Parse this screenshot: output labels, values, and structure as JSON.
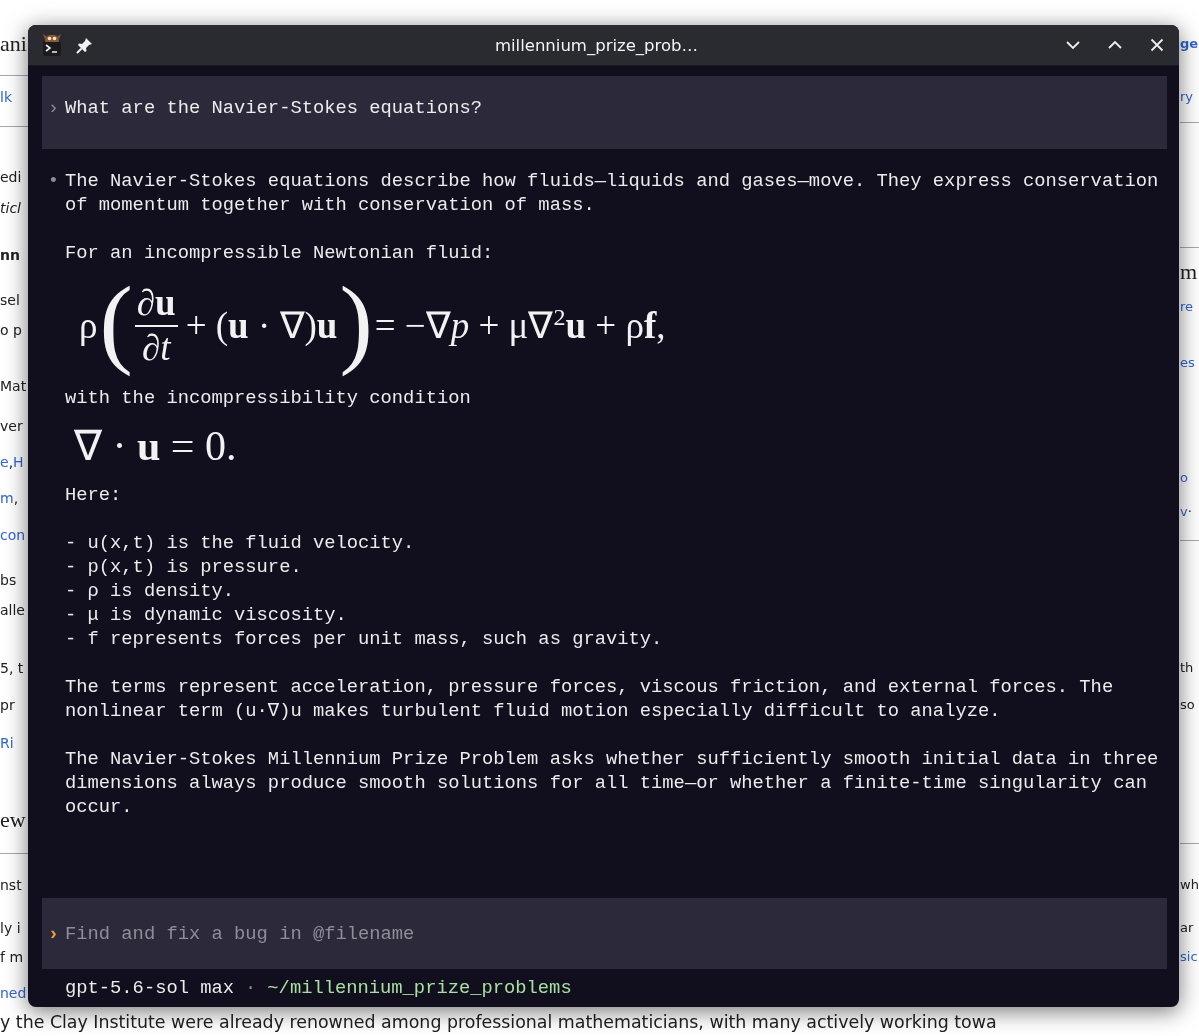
{
  "background_page": {
    "left_fragments": [
      {
        "kind": "heading",
        "parts": [
          {
            "text": "ani",
            "link": false
          }
        ]
      },
      {
        "kind": "text",
        "parts": [
          {
            "text": "lk",
            "link": true
          }
        ]
      },
      {
        "kind": "text",
        "parts": [
          {
            "text": "edi",
            "link": false
          }
        ]
      },
      {
        "kind": "italic",
        "parts": [
          {
            "text": "ticl",
            "link": false
          }
        ]
      },
      {
        "kind": "bold",
        "parts": [
          {
            "text": "nn",
            "link": false
          }
        ]
      },
      {
        "kind": "text",
        "parts": [
          {
            "text": "sel",
            "link": false
          }
        ]
      },
      {
        "kind": "text",
        "parts": [
          {
            "text": "o p",
            "link": false
          }
        ]
      },
      {
        "kind": "text",
        "parts": [
          {
            "text": "Mat",
            "link": false
          }
        ]
      },
      {
        "kind": "text",
        "parts": [
          {
            "text": "ver",
            "link": false
          }
        ]
      },
      {
        "kind": "text",
        "parts": [
          {
            "text": "e",
            "link": true
          },
          {
            "text": ",",
            "link": false
          },
          {
            "text": "H",
            "link": true
          }
        ]
      },
      {
        "kind": "text",
        "parts": [
          {
            "text": "m",
            "link": true
          },
          {
            "text": ",",
            "link": false
          }
        ]
      },
      {
        "kind": "text",
        "parts": [
          {
            "text": "con",
            "link": true
          }
        ]
      },
      {
        "kind": "text",
        "parts": [
          {
            "text": "bs",
            "link": false
          }
        ]
      },
      {
        "kind": "text",
        "parts": [
          {
            "text": "alle",
            "link": false
          }
        ]
      },
      {
        "kind": "text",
        "parts": [
          {
            "text": "5, t",
            "link": false
          }
        ]
      },
      {
        "kind": "text",
        "parts": [
          {
            "text": "pr",
            "link": false
          }
        ]
      },
      {
        "kind": "text",
        "parts": [
          {
            "text": "Ri",
            "link": true
          }
        ]
      },
      {
        "kind": "heading",
        "parts": [
          {
            "text": "ew",
            "link": false
          }
        ]
      },
      {
        "kind": "text",
        "parts": [
          {
            "text": "nst",
            "link": false
          }
        ]
      },
      {
        "kind": "text",
        "parts": [
          {
            "text": "ly i",
            "link": false
          }
        ]
      },
      {
        "kind": "text",
        "parts": [
          {
            "text": "f m",
            "link": false
          }
        ]
      },
      {
        "kind": "text",
        "parts": [
          {
            "text": "ned",
            "link": true
          }
        ]
      }
    ],
    "right_fragments": [
      {
        "kind": "bold",
        "parts": [
          {
            "text": "ge",
            "link": true
          }
        ]
      },
      {
        "kind": "text",
        "parts": [
          {
            "text": "ry",
            "link": true
          }
        ]
      },
      {
        "kind": "heading",
        "parts": [
          {
            "text": "m",
            "link": false
          }
        ]
      },
      {
        "kind": "text",
        "parts": [
          {
            "text": "re",
            "link": true
          }
        ]
      },
      {
        "kind": "text",
        "parts": [
          {
            "text": "es",
            "link": true
          }
        ]
      },
      {
        "kind": "text",
        "parts": [
          {
            "text": "o",
            "link": true
          }
        ]
      },
      {
        "kind": "text",
        "parts": [
          {
            "text": "v",
            "link": true
          },
          {
            "text": "·",
            "link": false
          }
        ]
      },
      {
        "kind": "text",
        "parts": [
          {
            "text": "th",
            "link": false
          }
        ]
      },
      {
        "kind": "text",
        "parts": [
          {
            "text": "so",
            "link": false
          }
        ]
      },
      {
        "kind": "text",
        "parts": [
          {
            "text": "wh",
            "link": false
          }
        ]
      },
      {
        "kind": "text",
        "parts": [
          {
            "text": "ar",
            "link": false
          }
        ]
      },
      {
        "kind": "text",
        "parts": [
          {
            "text": "sic",
            "link": true
          }
        ]
      }
    ],
    "bottom_line": "y the Clay Institute were already renowned among professional mathematicians, with many actively working towa"
  },
  "window": {
    "title": "millennium_prize_prob…"
  },
  "conversation": [
    {
      "kind": "user",
      "marker": "›",
      "blocks": [
        {
          "kind": "paragraph",
          "text": "What are the Navier-Stokes equations?"
        }
      ]
    },
    {
      "kind": "assistant",
      "marker": "•",
      "blocks": [
        {
          "kind": "paragraph",
          "text": "The Navier-Stokes equations describe how fluids—liquids and gases—move. They express conservation of momentum together with conservation of mass."
        },
        {
          "kind": "paragraph",
          "text": "For an incompressible Newtonian fluid:"
        },
        {
          "kind": "equation",
          "parts": [
            {
              "kind": "symbol",
              "text": "ρ"
            },
            {
              "kind": "paren",
              "text": "("
            },
            {
              "kind": "fraction",
              "numerator": "∂**u**",
              "denominator": "∂*t*"
            },
            {
              "kind": "symbol",
              "text": "+ (**u** · ∇)**u**"
            },
            {
              "kind": "paren",
              "text": ")"
            },
            {
              "kind": "symbol",
              "text": "= −∇*p* + μ∇$^{2}$**u** + ρ**f**,"
            }
          ]
        },
        {
          "kind": "paragraph",
          "text": "with the incompressibility condition"
        },
        {
          "kind": "equation",
          "parts": [
            {
              "kind": "symbol",
              "text": "∇ · **u** = 0."
            }
          ]
        },
        {
          "kind": "paragraph",
          "text": "Here:"
        },
        {
          "kind": "list",
          "items": [
            "- u(x,t) is the fluid velocity.",
            "- p(x,t) is pressure.",
            "- ρ is density.",
            "- μ is dynamic viscosity.",
            "- f represents forces per unit mass, such as gravity."
          ]
        },
        {
          "kind": "paragraph",
          "text": "The terms represent acceleration, pressure forces, viscous friction, and external forces. The nonlinear term (u·∇)u makes turbulent fluid motion especially difficult to analyze."
        },
        {
          "kind": "paragraph",
          "text": "The Navier-Stokes Millennium Prize Problem asks whether sufficiently smooth initial data in three dimensions always produce smooth solutions for all time—or whether a finite-time singularity can occur."
        }
      ]
    }
  ],
  "composer": {
    "marker": "›",
    "placeholder": "Find and fix a bug in @filename"
  },
  "status": {
    "model": "gpt-5.6-sol max",
    "separator": "·",
    "path": "~/millennium_prize_problems"
  }
}
